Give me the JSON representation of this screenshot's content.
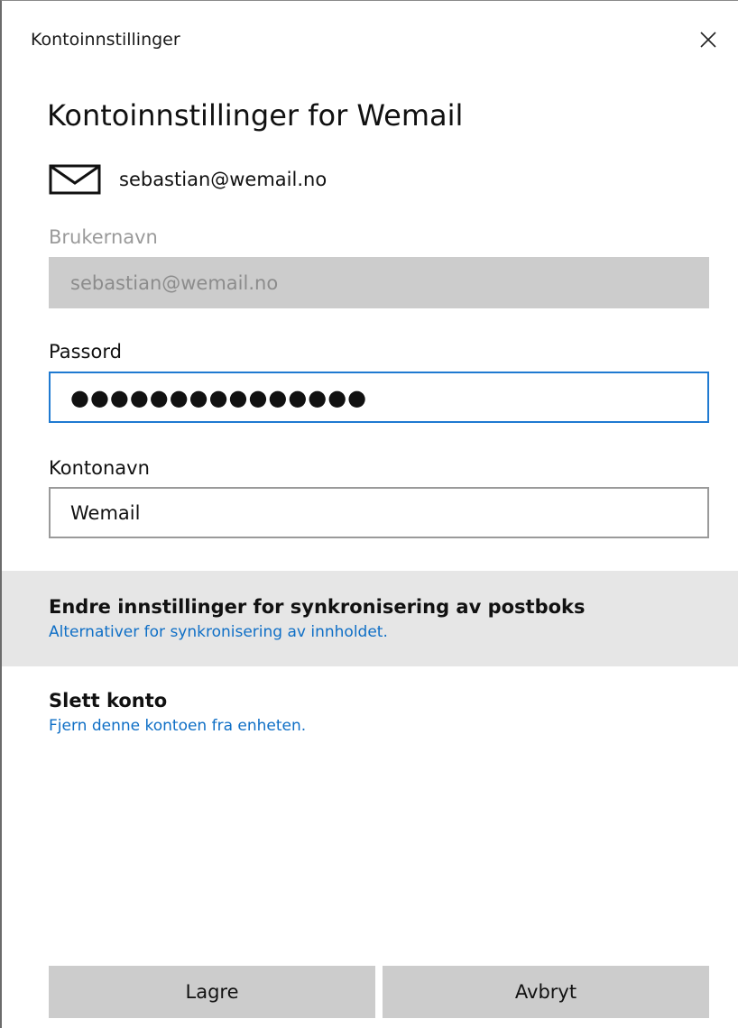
{
  "window": {
    "title": "Kontoinnstillinger"
  },
  "heading": "Kontoinnstillinger for Wemail",
  "account": {
    "email": "sebastian@wemail.no",
    "icon": "mail-icon"
  },
  "fields": {
    "username": {
      "label": "Brukernavn",
      "value": "sebastian@wemail.no",
      "disabled": true
    },
    "password": {
      "label": "Passord",
      "value": "●●●●●●●●●●●●●●●"
    },
    "account_name": {
      "label": "Kontonavn",
      "value": "Wemail"
    }
  },
  "actions": {
    "sync": {
      "title": "Endre innstillinger for synkronisering av postboks",
      "subtitle": "Alternativer for synkronisering av innholdet."
    },
    "delete": {
      "title": "Slett konto",
      "subtitle": "Fjern denne kontoen fra enheten."
    }
  },
  "buttons": {
    "save": "Lagre",
    "cancel": "Avbryt"
  },
  "colors": {
    "accent": "#1f7ad1",
    "link": "#0f6fc6",
    "button_bg": "#cccccc",
    "highlight_bg": "#e6e6e6"
  }
}
